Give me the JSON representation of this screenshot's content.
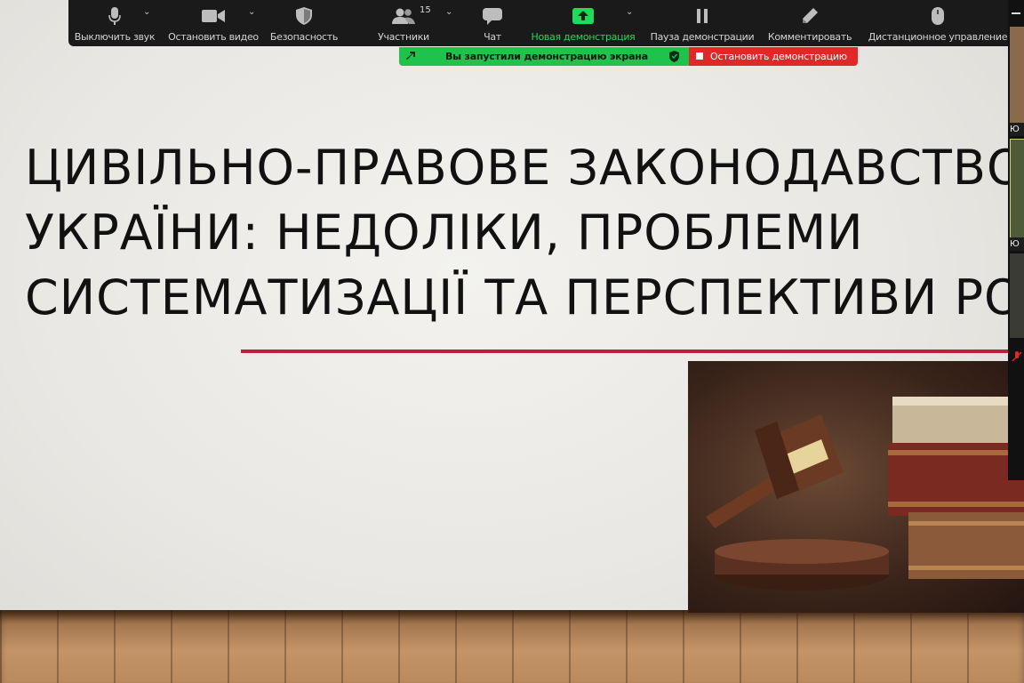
{
  "toolbar": {
    "mute_label": "Выключить звук",
    "stop_video_label": "Остановить видео",
    "security_label": "Безопасность",
    "participants_label": "Участники",
    "participants_count": "15",
    "chat_label": "Чат",
    "new_share_label": "Новая демонстрация",
    "pause_share_label": "Пауза демонстрации",
    "annotate_label": "Комментировать",
    "remote_control_label": "Дистанционное управление",
    "active_color": "#23d959"
  },
  "share_banner": {
    "message": "Вы запустили демонстрацию экрана",
    "stop_label": "Остановить демонстрацию",
    "banner_color": "#1fc24a",
    "stop_color": "#e02828"
  },
  "slide": {
    "title_lines": [
      "ЦИВІЛЬНО-ПРАВОВЕ ЗАКОНОДАВСТВО",
      "УКРАЇНИ: НЕДОЛІКИ, ПРОБЛЕМИ",
      "СИСТЕМАТИЗАЦІЇ ТА ПЕРСПЕКТИВИ РОЗВИТКУ"
    ],
    "accent_color": "#b8233b"
  },
  "video_strip": {
    "names": [
      "Ю",
      "Ю"
    ]
  }
}
